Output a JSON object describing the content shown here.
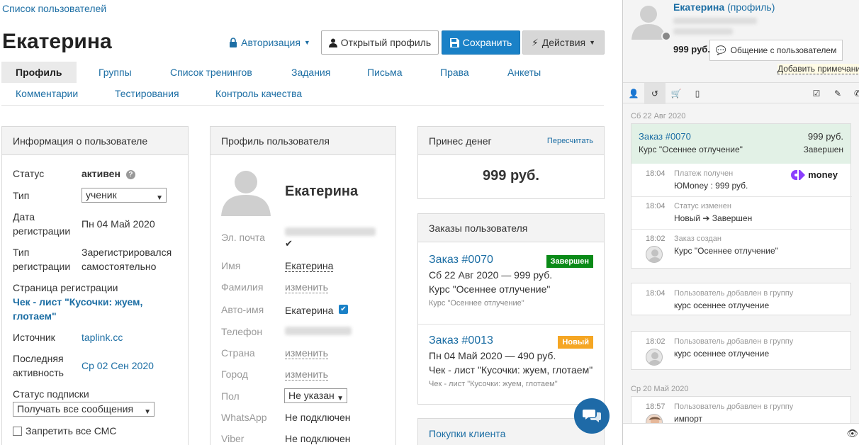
{
  "breadcrumb": "Список пользователей",
  "title": "Екатерина",
  "header": {
    "auth_label": "Авторизация",
    "open_profile_label": "Открытый профиль",
    "save_label": "Сохранить",
    "actions_label": "Действия"
  },
  "tabs_row1": [
    "Профиль",
    "Группы",
    "Список тренингов",
    "Задания",
    "Письма",
    "Права",
    "Анкеты"
  ],
  "tabs_row2": [
    "Комментарии",
    "Тестирования",
    "Контроль качества"
  ],
  "user_info": {
    "header": "Информация о пользователе",
    "status_label": "Статус",
    "status_value": "активен",
    "type_label": "Тип",
    "type_value": "ученик",
    "reg_date_label_1": "Дата",
    "reg_date_label_2": "регистрации",
    "reg_date_value": "Пн 04 Май 2020",
    "reg_type_label_1": "Тип",
    "reg_type_label_2": "регистрации",
    "reg_type_value_1": "Зарегистрировался",
    "reg_type_value_2": "самостоятельно",
    "reg_page_label": "Страница регистрации",
    "reg_page_value_1": "Чек - лист \"Кусочки: жуем,",
    "reg_page_value_2": "глотаем\"",
    "source_label": "Источник",
    "source_value": "taplink.cc",
    "last_activity_label_1": "Последняя",
    "last_activity_label_2": "активность",
    "last_activity_value": "Ср 02 Сен 2020",
    "subscription_label": "Статус подписки",
    "subscription_value": "Получать все сообщения",
    "sms_label": "Запретить все СМС"
  },
  "profile": {
    "header": "Профиль пользователя",
    "name": "Екатерина",
    "email_label": "Эл. почта",
    "first_name_label": "Имя",
    "first_name_value": "Екатерина",
    "last_name_label": "Фамилия",
    "change_label": "изменить",
    "auto_name_label": "Авто-имя",
    "auto_name_value": "Екатерина",
    "phone_label": "Телефон",
    "country_label": "Страна",
    "city_label": "Город",
    "gender_label": "Пол",
    "gender_value": "Не указан",
    "whatsapp_label": "WhatsApp",
    "whatsapp_value": "Не подключен",
    "viber_label": "Viber",
    "viber_value": "Не подключен"
  },
  "money": {
    "header": "Принес денег",
    "recalc": "Пересчитать",
    "amount": "999 руб."
  },
  "orders": {
    "header": "Заказы пользователя",
    "items": [
      {
        "link": "Заказ #0070",
        "badge": "Завершен",
        "badge_color": "#0a8a17",
        "line1": "Сб 22 Авг 2020 — 999 руб.",
        "line2": "Курс \"Осеннее отлучение\"",
        "sub": "Курс \"Осеннее отлучение\""
      },
      {
        "link": "Заказ #0013",
        "badge": "Новый",
        "badge_color": "#f5a623",
        "line1": "Пн 04 Май 2020 — 490 руб.",
        "line2": "Чек - лист \"Кусочки: жуем, глотаем\"",
        "sub": "Чек - лист \"Кусочки: жуем, глотаем\""
      }
    ]
  },
  "purchases": {
    "header": "Покупки клиента"
  },
  "sidebar": {
    "name": "Екатерина",
    "profile_link": "(профиль)",
    "amount": "999 руб.",
    "chat_button": "Общение с пользователем",
    "add_note": "Добавить примечание",
    "dates": [
      "Сб 22 Авг 2020",
      "Ср 20 Май 2020"
    ],
    "order_card": {
      "link": "Заказ #0070",
      "amount": "999 руб.",
      "title": "Курс \"Осеннее отлучение\"",
      "status": "Завершен"
    },
    "order_events": [
      {
        "time": "18:04",
        "title": "Платеж получен",
        "text": "ЮMoney : 999 руб.",
        "brand": "money"
      },
      {
        "time": "18:04",
        "title": "Статус изменен",
        "text": "Новый ➔ Завершен"
      },
      {
        "time": "18:02",
        "title": "Заказ создан",
        "text": "Курс \"Осеннее отлучение\""
      }
    ],
    "group_events": [
      {
        "time": "18:04",
        "title": "Пользователь добавлен в группу",
        "text": "курс осеннее отлучение"
      },
      {
        "time": "18:02",
        "title": "Пользователь добавлен в группу",
        "text": "курс осеннее отлучение"
      },
      {
        "time": "18:57",
        "title": "Пользователь добавлен в группу",
        "text": "импорт"
      }
    ]
  }
}
